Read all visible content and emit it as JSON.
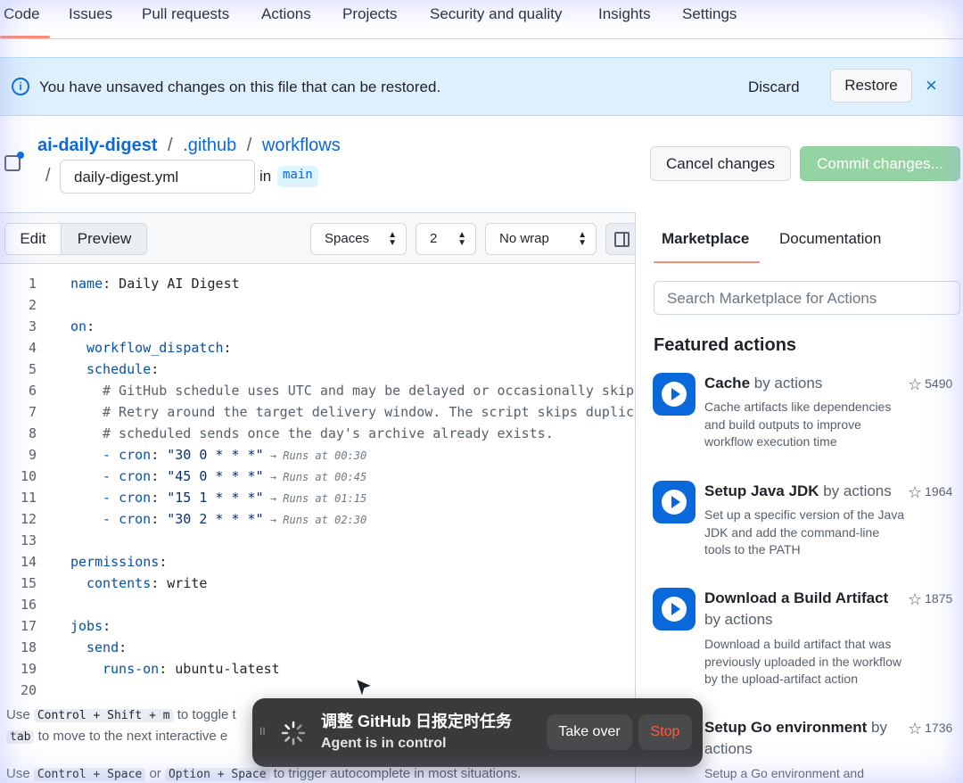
{
  "topnav": {
    "tabs": [
      "Code",
      "Issues",
      "Pull requests",
      "Actions",
      "Projects",
      "Security and quality",
      "Insights",
      "Settings"
    ],
    "active": "Code"
  },
  "banner": {
    "message": "You have unsaved changes on this file that can be restored.",
    "discard": "Discard",
    "restore": "Restore",
    "close": "×"
  },
  "breadcrumb": {
    "repo": "ai-daily-digest",
    "sep": "/",
    "dir1": ".github",
    "dir2": "workflows",
    "filename": "daily-digest.yml",
    "in_label": "in",
    "branch": "main"
  },
  "actions": {
    "cancel": "Cancel changes",
    "commit": "Commit changes..."
  },
  "editor": {
    "edit": "Edit",
    "preview": "Preview",
    "indent_mode": "Spaces",
    "indent_size": "2",
    "wrap_mode": "No wrap"
  },
  "code_lines": [
    {
      "n": "1"
    },
    {
      "n": "2"
    },
    {
      "n": "3"
    },
    {
      "n": "4"
    },
    {
      "n": "5"
    },
    {
      "n": "6"
    },
    {
      "n": "7"
    },
    {
      "n": "8"
    },
    {
      "n": "9"
    },
    {
      "n": "10"
    },
    {
      "n": "11"
    },
    {
      "n": "12"
    },
    {
      "n": "13"
    },
    {
      "n": "14"
    },
    {
      "n": "15"
    },
    {
      "n": "16"
    },
    {
      "n": "17"
    },
    {
      "n": "18"
    },
    {
      "n": "19"
    },
    {
      "n": "20"
    }
  ],
  "code": {
    "l1_key": "name",
    "l1_val": ": Daily AI Digest",
    "l3_key": "on",
    "l3_colon": ":",
    "l4_key": "workflow_dispatch",
    "l4_colon": ":",
    "l5_key": "schedule",
    "l5_colon": ":",
    "l6": "# GitHub schedule uses UTC and may be delayed or occasionally skipped",
    "l7": "# Retry around the target delivery window. The script skips duplicate",
    "l8": "# scheduled sends once the day's archive already exists.",
    "dash": "- ",
    "cron": "cron",
    "colon": ": ",
    "c9": "\"30 0 * * *\"",
    "h9": " → Runs at 00:30",
    "c10": "\"45 0 * * *\"",
    "h10": " → Runs at 00:45",
    "c11": "\"15 1 * * *\"",
    "h11": " → Runs at 01:15",
    "c12": "\"30 2 * * *\"",
    "h12": " → Runs at 02:30",
    "l14_key": "permissions",
    "l14_colon": ":",
    "l15_key": "contents",
    "l15_val": ": write",
    "l17_key": "jobs",
    "l17_colon": ":",
    "l18_key": "send",
    "l18_colon": ":",
    "l19_key": "runs-on",
    "l19_val": ": ubuntu-latest"
  },
  "side": {
    "tab_marketplace": "Marketplace",
    "tab_docs": "Documentation",
    "search_placeholder": "Search Marketplace for Actions",
    "featured": "Featured actions",
    "items": [
      {
        "name": "Cache",
        "by": " by actions",
        "stars": "5490",
        "desc": "Cache artifacts like dependencies and build outputs to improve workflow execution time"
      },
      {
        "name": "Setup Java JDK",
        "by": " by actions",
        "stars": "1964",
        "desc": "Set up a specific version of the Java JDK and add the command-line tools to the PATH"
      },
      {
        "name": "Download a Build Artifact",
        "by": " by actions",
        "stars": "1875",
        "desc": "Download a build artifact that was previously uploaded in the workflow by the upload-artifact action"
      },
      {
        "name": "Setup Go environment",
        "by": " by actions",
        "stars": "1736",
        "desc": "Setup a Go environment and"
      }
    ]
  },
  "hints": {
    "h1a": "Use",
    "k1": "Control + Shift + m",
    "h1b": "to toggle t",
    "k2": "tab",
    "h2b": "to move to the next interactive e",
    "h3a": "Use",
    "k3": "Control + Space",
    "h3b": "or",
    "k4": "Option + Space",
    "h3c": "to trigger autocomplete in most situations."
  },
  "toast": {
    "title": "调整 GitHub 日报定时任务",
    "subtitle": "Agent is in control",
    "takeover": "Take over",
    "stop": "Stop",
    "pause": "II"
  }
}
